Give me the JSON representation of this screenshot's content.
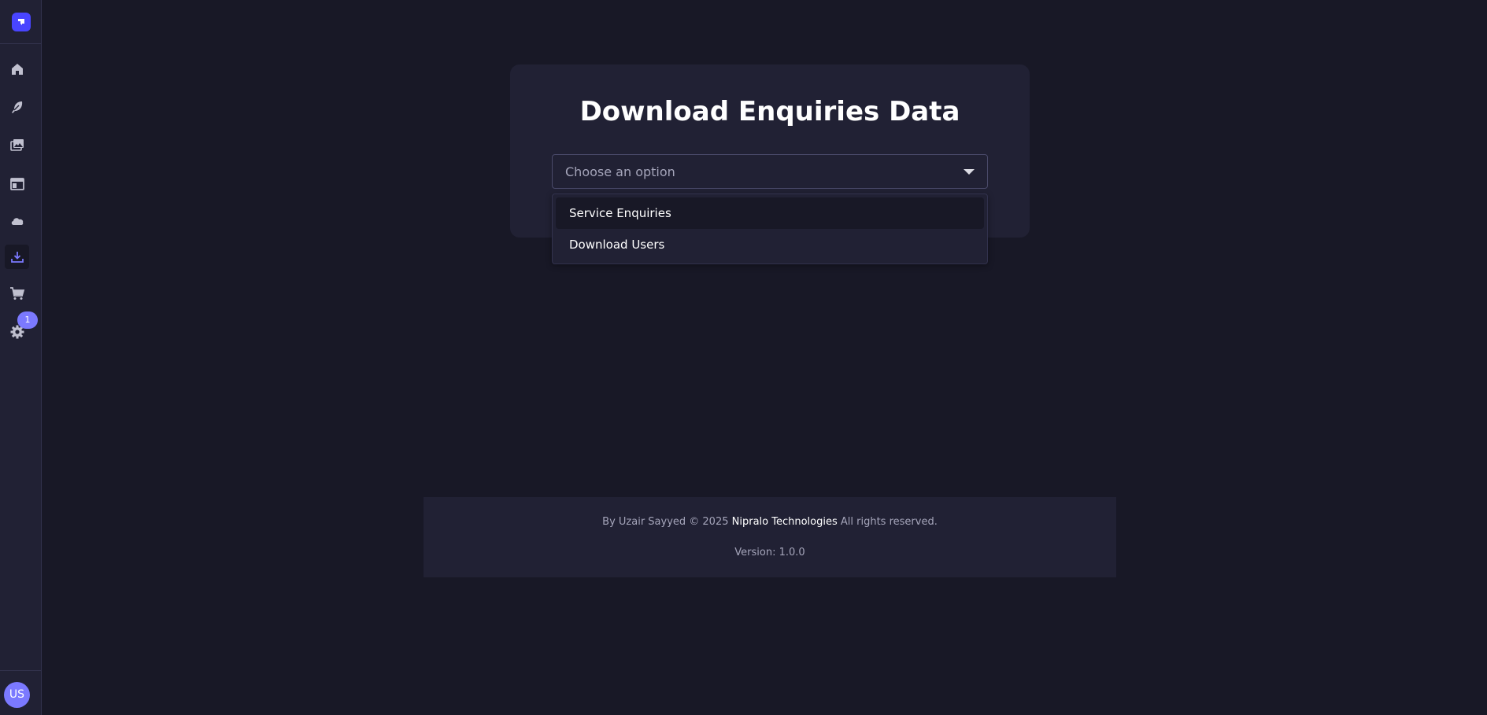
{
  "sidebar": {
    "logo_icon": "strapi-logo-icon",
    "items": [
      {
        "icon": "home-icon"
      },
      {
        "icon": "feather-icon"
      },
      {
        "icon": "images-icon"
      },
      {
        "icon": "layout-icon"
      },
      {
        "icon": "cloud-icon"
      },
      {
        "icon": "download-icon",
        "active": true
      },
      {
        "icon": "cart-icon"
      },
      {
        "icon": "gear-icon"
      }
    ],
    "settings_badge": "1",
    "avatar_initials": "US"
  },
  "card": {
    "title": "Download Enquiries Data",
    "select_placeholder": "Choose an option"
  },
  "dropdown": {
    "options": [
      "Service Enquiries",
      "Download Users"
    ]
  },
  "footer": {
    "prefix": "By Uzair Sayyed © 2025",
    "brand": "Nipralo Technologies",
    "suffix": "All rights reserved.",
    "version": "Version: 1.0.0"
  },
  "colors": {
    "background": "#181826",
    "panel": "#212134",
    "accent": "#7b79ff",
    "logo": "#4945ff"
  }
}
